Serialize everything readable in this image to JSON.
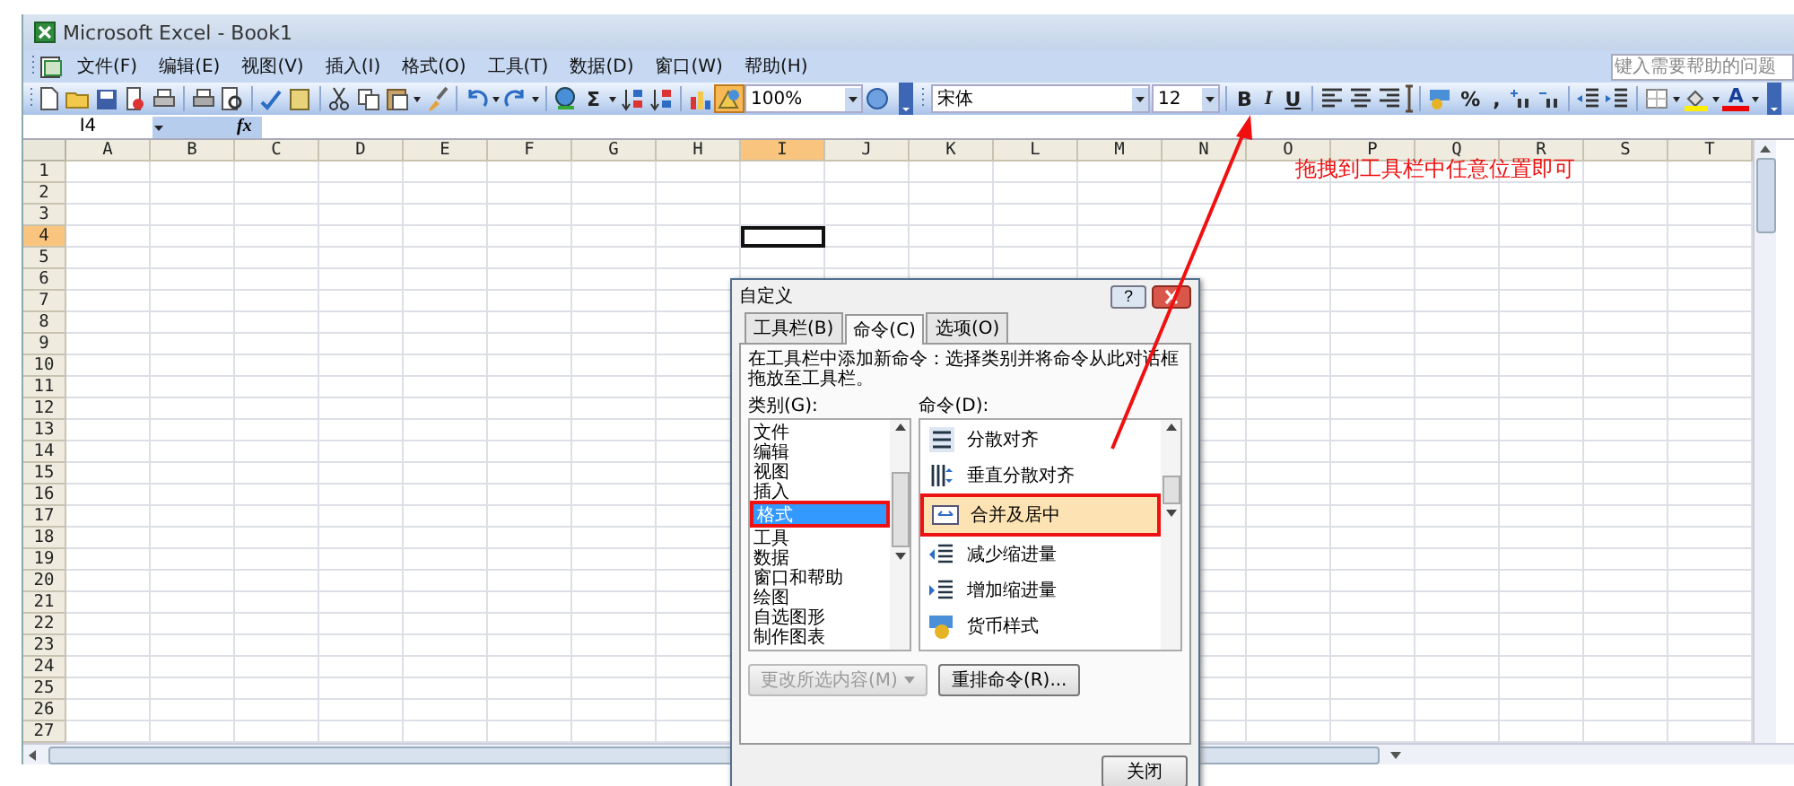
{
  "window": {
    "title": "Microsoft Excel - Book1"
  },
  "menu": [
    "文件(F)",
    "编辑(E)",
    "视图(V)",
    "插入(I)",
    "格式(O)",
    "工具(T)",
    "数据(D)",
    "窗口(W)",
    "帮助(H)"
  ],
  "help_search": {
    "placeholder": "键入需要帮助的问题"
  },
  "toolbar": {
    "sum_glyph": "Σ",
    "drawing_button_on": true,
    "zoom": "100%",
    "font": "宋体",
    "font_size": "12",
    "style_glyphs": [
      "B",
      "I",
      "U"
    ],
    "number_glyphs": [
      "%",
      ","
    ],
    "font_color_glyph": "A"
  },
  "formula_bar": {
    "name_box": "I4",
    "function_glyph": "fx"
  },
  "columns": [
    {
      "label": "A",
      "selected": false
    },
    {
      "label": "B",
      "selected": false
    },
    {
      "label": "C",
      "selected": false
    },
    {
      "label": "D",
      "selected": false
    },
    {
      "label": "E",
      "selected": false
    },
    {
      "label": "F",
      "selected": false
    },
    {
      "label": "G",
      "selected": false
    },
    {
      "label": "H",
      "selected": false
    },
    {
      "label": "I",
      "selected": true
    },
    {
      "label": "J",
      "selected": false
    },
    {
      "label": "K",
      "selected": false
    },
    {
      "label": "L",
      "selected": false
    },
    {
      "label": "M",
      "selected": false
    },
    {
      "label": "N",
      "selected": false
    },
    {
      "label": "O",
      "selected": false
    },
    {
      "label": "P",
      "selected": false
    },
    {
      "label": "Q",
      "selected": false
    },
    {
      "label": "R",
      "selected": false
    },
    {
      "label": "S",
      "selected": false
    },
    {
      "label": "T",
      "selected": false
    }
  ],
  "rows": [
    {
      "label": "1",
      "selected": false
    },
    {
      "label": "2",
      "selected": false
    },
    {
      "label": "3",
      "selected": false
    },
    {
      "label": "4",
      "selected": true
    },
    {
      "label": "5",
      "selected": false
    },
    {
      "label": "6",
      "selected": false
    },
    {
      "label": "7",
      "selected": false
    },
    {
      "label": "8",
      "selected": false
    },
    {
      "label": "9",
      "selected": false
    },
    {
      "label": "10",
      "selected": false
    },
    {
      "label": "11",
      "selected": false
    },
    {
      "label": "12",
      "selected": false
    },
    {
      "label": "13",
      "selected": false
    },
    {
      "label": "14",
      "selected": false
    },
    {
      "label": "15",
      "selected": false
    },
    {
      "label": "16",
      "selected": false
    },
    {
      "label": "17",
      "selected": false
    },
    {
      "label": "18",
      "selected": false
    },
    {
      "label": "19",
      "selected": false
    },
    {
      "label": "20",
      "selected": false
    },
    {
      "label": "21",
      "selected": false
    },
    {
      "label": "22",
      "selected": false
    },
    {
      "label": "23",
      "selected": false
    },
    {
      "label": "24",
      "selected": false
    },
    {
      "label": "25",
      "selected": false
    },
    {
      "label": "26",
      "selected": false
    },
    {
      "label": "27",
      "selected": false
    }
  ],
  "dialog": {
    "title": "自定义",
    "help_glyph": "?",
    "tabs": [
      {
        "label": "工具栏(B)",
        "selected": false
      },
      {
        "label": "命令(C)",
        "selected": true
      },
      {
        "label": "选项(O)",
        "selected": false
      }
    ],
    "description": "在工具栏中添加新命令：选择类别并将命令从此对话框拖放至工具栏。",
    "categories_label": "类别(G):",
    "commands_label": "命令(D):",
    "categories": [
      {
        "label": "文件",
        "selected": false
      },
      {
        "label": "编辑",
        "selected": false
      },
      {
        "label": "视图",
        "selected": false
      },
      {
        "label": "插入",
        "selected": false
      },
      {
        "label": "格式",
        "selected": true
      },
      {
        "label": "工具",
        "selected": false
      },
      {
        "label": "数据",
        "selected": false
      },
      {
        "label": "窗口和帮助",
        "selected": false
      },
      {
        "label": "绘图",
        "selected": false
      },
      {
        "label": "自选图形",
        "selected": false
      },
      {
        "label": "制作图表",
        "selected": false
      }
    ],
    "commands": [
      {
        "label": "分散对齐",
        "selected": false
      },
      {
        "label": "垂直分散对齐",
        "selected": false
      },
      {
        "label": "合并及居中",
        "selected": true
      },
      {
        "label": "减少缩进量",
        "selected": false
      },
      {
        "label": "增加缩进量",
        "selected": false
      },
      {
        "label": "货币样式",
        "selected": false
      }
    ],
    "modify_button": {
      "label": "更改所选内容(M)",
      "disabled": true
    },
    "rearrange_button": "重排命令(R)...",
    "close_button": "关闭"
  },
  "annotation": {
    "text": "拖拽到工具栏中任意位置即可"
  }
}
